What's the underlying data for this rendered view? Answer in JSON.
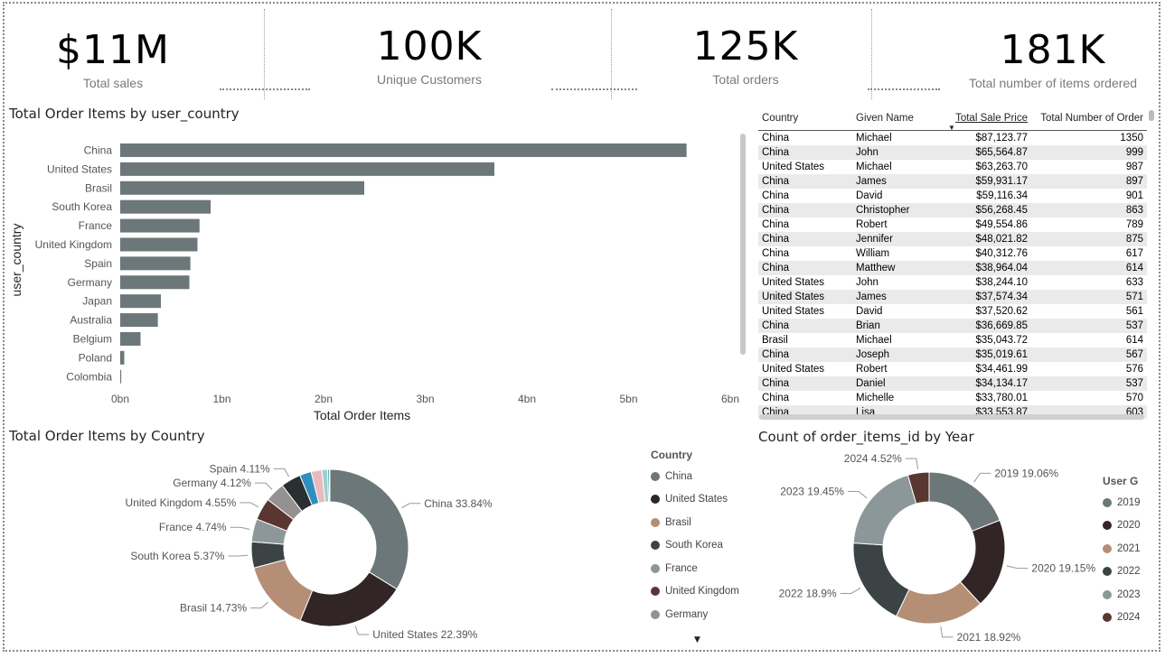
{
  "kpis": [
    {
      "value": "$11M",
      "label": "Total sales"
    },
    {
      "value": "100K",
      "label": "Unique Customers"
    },
    {
      "value": "125K",
      "label": "Total orders"
    },
    {
      "value": "181K",
      "label": "Total number of items ordered"
    }
  ],
  "bar_title": "Total Order Items by user_country",
  "donut1_title": "Total Order Items by Country",
  "donut2_title": "Count of order_items_id by Year",
  "table": {
    "headers": [
      "Country",
      "Given Name",
      "Total Sale Price",
      "Total Number of Order"
    ],
    "rows": [
      [
        "China",
        "Michael",
        "$87,123.77",
        "1350"
      ],
      [
        "China",
        "John",
        "$65,564.87",
        "999"
      ],
      [
        "United States",
        "Michael",
        "$63,263.70",
        "987"
      ],
      [
        "China",
        "James",
        "$59,931.17",
        "897"
      ],
      [
        "China",
        "David",
        "$59,116.34",
        "901"
      ],
      [
        "China",
        "Christopher",
        "$56,268.45",
        "863"
      ],
      [
        "China",
        "Robert",
        "$49,554.86",
        "789"
      ],
      [
        "China",
        "Jennifer",
        "$48,021.82",
        "875"
      ],
      [
        "China",
        "William",
        "$40,312.76",
        "617"
      ],
      [
        "China",
        "Matthew",
        "$38,964.04",
        "614"
      ],
      [
        "United States",
        "John",
        "$38,244.10",
        "633"
      ],
      [
        "United States",
        "James",
        "$37,574.34",
        "571"
      ],
      [
        "United States",
        "David",
        "$37,520.62",
        "561"
      ],
      [
        "China",
        "Brian",
        "$36,669.85",
        "537"
      ],
      [
        "Brasil",
        "Michael",
        "$35,043.72",
        "614"
      ],
      [
        "China",
        "Joseph",
        "$35,019.61",
        "567"
      ],
      [
        "United States",
        "Robert",
        "$34,461.99",
        "576"
      ],
      [
        "China",
        "Daniel",
        "$34,134.17",
        "537"
      ],
      [
        "China",
        "Michelle",
        "$33,780.01",
        "570"
      ],
      [
        "China",
        "Lisa",
        "$33,553.87",
        "603"
      ]
    ]
  },
  "legend1": {
    "title": "Country",
    "items": [
      {
        "label": "China",
        "color": "#6b7778"
      },
      {
        "label": "United States",
        "color": "#312525"
      },
      {
        "label": "Brasil",
        "color": "#b48e75"
      },
      {
        "label": "South Korea",
        "color": "#3b4345"
      },
      {
        "label": "France",
        "color": "#8c9799"
      },
      {
        "label": "United Kingdom",
        "color": "#5a3630"
      },
      {
        "label": "Germany",
        "color": "#959190"
      }
    ]
  },
  "legend2": {
    "title": "User G",
    "items": [
      {
        "label": "2019",
        "color": "#6b7778"
      },
      {
        "label": "2020",
        "color": "#312525"
      },
      {
        "label": "2021",
        "color": "#b48e75"
      },
      {
        "label": "2022",
        "color": "#3b4345"
      },
      {
        "label": "2023",
        "color": "#8c9799"
      },
      {
        "label": "2024",
        "color": "#5a3630"
      }
    ]
  },
  "chart_data": [
    {
      "type": "bar",
      "orientation": "horizontal",
      "title": "Total Order Items by user_country",
      "xlabel": "Total Order Items",
      "ylabel": "user_country",
      "categories": [
        "China",
        "United States",
        "Brasil",
        "South Korea",
        "France",
        "United Kingdom",
        "Spain",
        "Germany",
        "Japan",
        "Australia",
        "Belgium",
        "Poland",
        "Colombia"
      ],
      "values": [
        5.57,
        3.68,
        2.4,
        0.89,
        0.78,
        0.76,
        0.69,
        0.68,
        0.4,
        0.37,
        0.2,
        0.04,
        0.01
      ],
      "xticks": [
        "0bn",
        "1bn",
        "2bn",
        "3bn",
        "4bn",
        "5bn",
        "6bn"
      ],
      "xlim": [
        0,
        6
      ],
      "color": "#6b7778",
      "grid": false
    },
    {
      "type": "pie",
      "title": "Total Order Items by Country",
      "slices": [
        {
          "label": "China",
          "value": 33.84,
          "text": "China 33.84%",
          "color": "#6b7778"
        },
        {
          "label": "United States",
          "value": 22.39,
          "text": "United States 22.39%",
          "color": "#312525"
        },
        {
          "label": "Brasil",
          "value": 14.73,
          "text": "Brasil 14.73%",
          "color": "#b48e75"
        },
        {
          "label": "South Korea",
          "value": 5.37,
          "text": "South Korea 5.37%",
          "color": "#3b4345"
        },
        {
          "label": "France",
          "value": 4.74,
          "text": "France 4.74%",
          "color": "#8c9799"
        },
        {
          "label": "United Kingdom",
          "value": 4.55,
          "text": "United Kingdom 4.55%",
          "color": "#5a3630"
        },
        {
          "label": "Germany",
          "value": 4.12,
          "text": "Germany 4.12%",
          "color": "#959190"
        },
        {
          "label": "Spain",
          "value": 4.11,
          "text": "Spain 4.11%",
          "color": "#2a2f31"
        },
        {
          "label": "Japan",
          "value": 2.4,
          "text": "",
          "color": "#2f8fbf"
        },
        {
          "label": "Australia",
          "value": 2.2,
          "text": "",
          "color": "#e9b9bd"
        },
        {
          "label": "Belgium",
          "value": 1.2,
          "text": "",
          "color": "#9fcfcf"
        },
        {
          "label": "Poland",
          "value": 0.35,
          "text": "",
          "color": "#2ba3a0"
        },
        {
          "label": "Colombia",
          "value": 0.1,
          "text": "",
          "color": "#c9d9da"
        }
      ]
    },
    {
      "type": "pie",
      "title": "Count of order_items_id by Year",
      "slices": [
        {
          "label": "2019",
          "value": 19.06,
          "text": "2019 19.06%",
          "color": "#6b7778"
        },
        {
          "label": "2020",
          "value": 19.15,
          "text": "2020 19.15%",
          "color": "#312525"
        },
        {
          "label": "2021",
          "value": 18.92,
          "text": "2021 18.92%",
          "color": "#b48e75"
        },
        {
          "label": "2022",
          "value": 18.9,
          "text": "2022 18.9%",
          "color": "#3b4345"
        },
        {
          "label": "2023",
          "value": 19.45,
          "text": "2023 19.45%",
          "color": "#8c9799"
        },
        {
          "label": "2024",
          "value": 4.52,
          "text": "2024 4.52%",
          "color": "#5a3630"
        }
      ]
    }
  ]
}
